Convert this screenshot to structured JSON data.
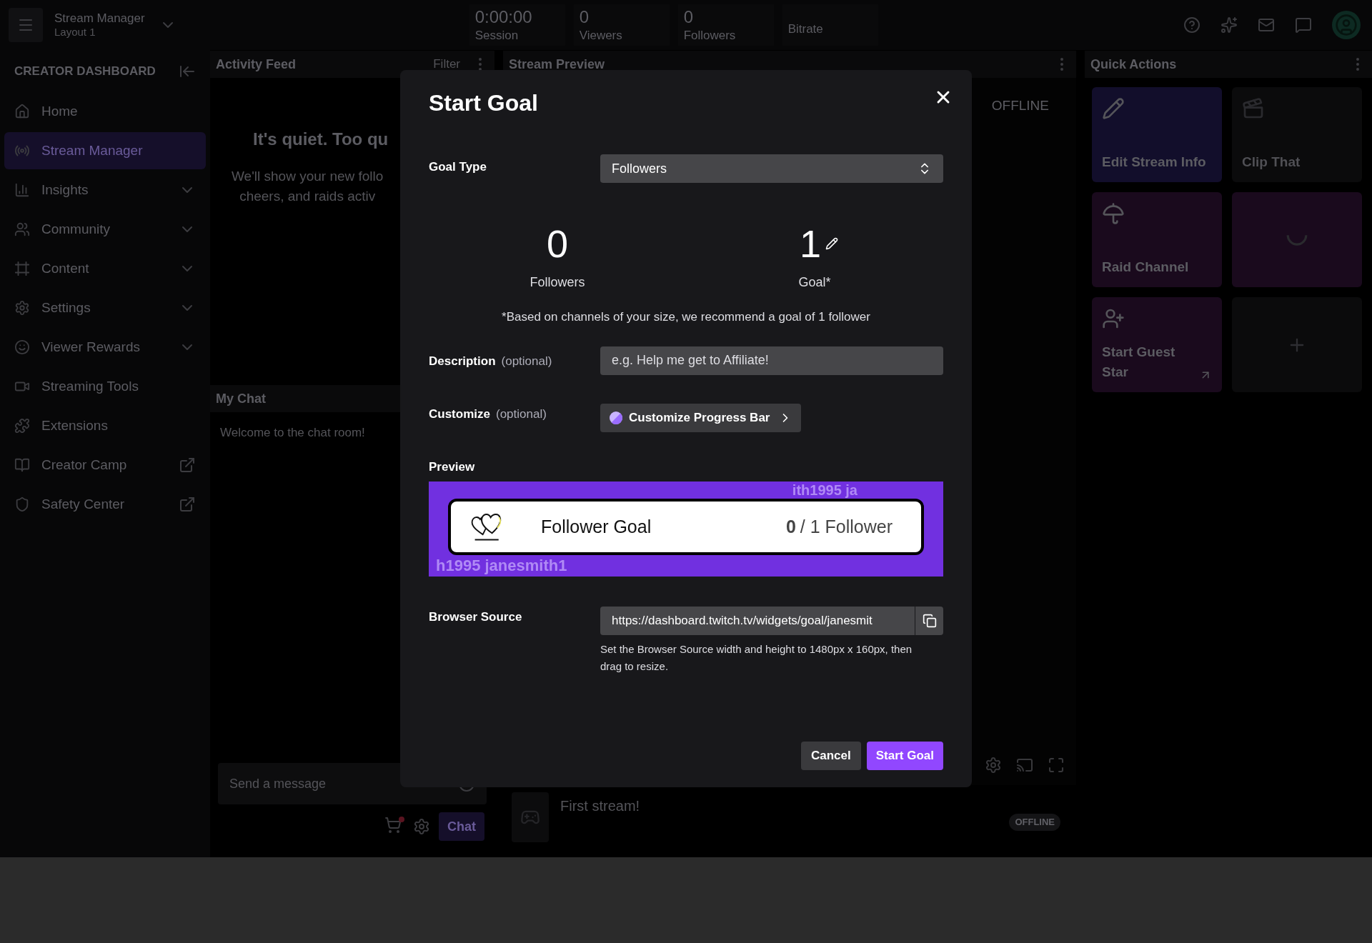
{
  "top_bar": {
    "title": "Stream Manager",
    "subtitle": "Layout 1",
    "stats": [
      {
        "value": "0:00:00",
        "label": "Session"
      },
      {
        "value": "0",
        "label": "Viewers"
      },
      {
        "value": "0",
        "label": "Followers"
      },
      {
        "label": "Bitrate"
      }
    ]
  },
  "sidebar": {
    "heading": "CREATOR DASHBOARD",
    "items": [
      {
        "label": "Home",
        "kind": "plain",
        "selected": false
      },
      {
        "label": "Stream Manager",
        "kind": "plain",
        "selected": true
      },
      {
        "label": "Insights",
        "kind": "expandable",
        "selected": false
      },
      {
        "label": "Community",
        "kind": "expandable",
        "selected": false
      },
      {
        "label": "Content",
        "kind": "expandable",
        "selected": false
      },
      {
        "label": "Settings",
        "kind": "expandable",
        "selected": false
      },
      {
        "label": "Viewer Rewards",
        "kind": "expandable",
        "selected": false
      },
      {
        "label": "Streaming Tools",
        "kind": "plain",
        "selected": false
      },
      {
        "label": "Extensions",
        "kind": "plain",
        "selected": false
      },
      {
        "label": "Creator Camp",
        "kind": "external",
        "selected": false
      },
      {
        "label": "Safety Center",
        "kind": "external",
        "selected": false
      }
    ]
  },
  "activity_feed": {
    "title": "Activity Feed",
    "filter": "Filter",
    "empty_title": "It's quiet. Too qu",
    "empty_lines": [
      "We'll show your new follo",
      "cheers, and raids activ"
    ]
  },
  "chat": {
    "title": "My Chat",
    "welcome": "Welcome to the chat room!",
    "placeholder": "Send a message",
    "send": "Chat"
  },
  "stream_preview": {
    "title": "Stream Preview",
    "status": "OFFLINE",
    "stream_title": "First stream!",
    "badge": "OFFLINE"
  },
  "quick_actions": {
    "title": "Quick Actions",
    "tiles": [
      {
        "kind": "action",
        "label": "Edit Stream Info",
        "color": "#120e2b",
        "external": false
      },
      {
        "kind": "action",
        "label": "Clip That",
        "color": "#0b0b0c",
        "external": false
      },
      {
        "kind": "action",
        "label": "Raid Channel",
        "color": "#1a0a1d",
        "external": false
      },
      {
        "kind": "loading",
        "color": "#1a0a1d"
      },
      {
        "kind": "action",
        "label": "Start Guest Star",
        "color": "#1a0a1d",
        "external": true
      },
      {
        "kind": "add",
        "color": "#0b0b0c"
      }
    ]
  },
  "modal": {
    "title": "Start Goal",
    "goal_type": {
      "label": "Goal Type",
      "value": "Followers"
    },
    "current": {
      "value": "0",
      "label": "Followers"
    },
    "goal": {
      "value": "1",
      "label": "Goal*"
    },
    "note": "*Based on channels of your size, we recommend a goal of 1 follower",
    "description": {
      "label": "Description",
      "optional": "(optional)",
      "placeholder": "e.g. Help me get to Affiliate!"
    },
    "customize": {
      "label": "Customize",
      "optional": "(optional)",
      "button": "Customize Progress Bar"
    },
    "preview": {
      "label": "Preview",
      "background_text": [
        "ith1995 ja",
        "h1995 janesmith1"
      ],
      "title": "Follower Goal",
      "count": "0",
      "total": "/ 1 Follower"
    },
    "browser_source": {
      "label": "Browser Source",
      "url": "https://dashboard.twitch.tv/widgets/goal/janesmit",
      "hint": "Set the Browser Source width and height to 1480px x 160px, then drag to resize."
    },
    "buttons": {
      "cancel": "Cancel",
      "confirm": "Start Goal"
    }
  }
}
